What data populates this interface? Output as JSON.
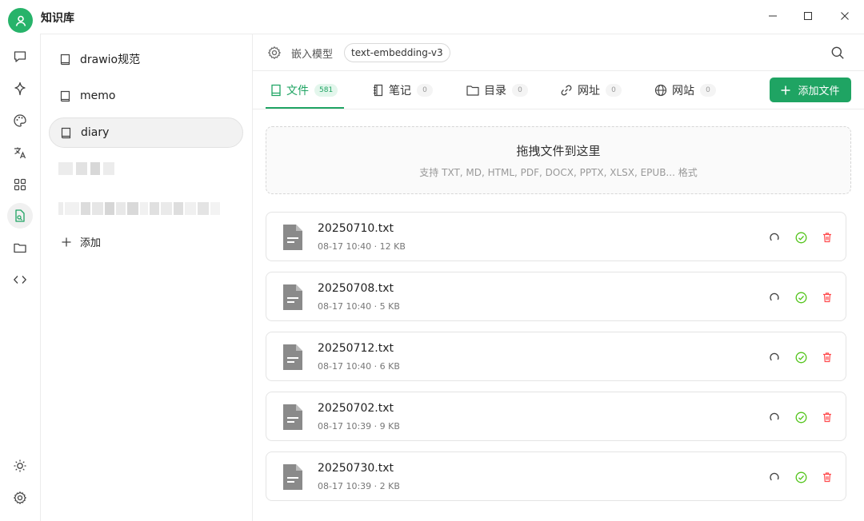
{
  "app": {
    "title": "知识库"
  },
  "window_controls": {
    "minimize": "minimize-icon",
    "maximize": "maximize-icon",
    "close": "close-icon"
  },
  "rail": {
    "items": [
      {
        "icon": "chat-icon"
      },
      {
        "icon": "sparkle-icon"
      },
      {
        "icon": "palette-icon"
      },
      {
        "icon": "translate-icon"
      },
      {
        "icon": "apps-grid-icon"
      },
      {
        "icon": "knowledge-file-icon",
        "active": true
      },
      {
        "icon": "folder-icon"
      },
      {
        "icon": "code-icon"
      }
    ],
    "bottom": [
      {
        "icon": "sun-icon"
      },
      {
        "icon": "settings-icon"
      }
    ]
  },
  "knowledge_bases": {
    "items": [
      {
        "label": "drawio规范"
      },
      {
        "label": "memo"
      },
      {
        "label": "diary",
        "active": true
      }
    ],
    "add_label": "添加"
  },
  "model_bar": {
    "label": "嵌入模型",
    "model": "text-embedding-v3"
  },
  "tabs": [
    {
      "label": "文件",
      "count": "581",
      "active": true
    },
    {
      "label": "笔记",
      "count": "0"
    },
    {
      "label": "目录",
      "count": "0"
    },
    {
      "label": "网址",
      "count": "0"
    },
    {
      "label": "网站",
      "count": "0"
    }
  ],
  "add_file_button": {
    "label": "添加文件"
  },
  "drop_zone": {
    "title": "拖拽文件到这里",
    "subtitle": "支持 TXT, MD, HTML, PDF, DOCX, PPTX, XLSX, EPUB... 格式"
  },
  "files": [
    {
      "name": "20250710.txt",
      "meta": "08-17 10:40 · 12 KB"
    },
    {
      "name": "20250708.txt",
      "meta": "08-17 10:40 · 5 KB"
    },
    {
      "name": "20250712.txt",
      "meta": "08-17 10:40 · 6 KB"
    },
    {
      "name": "20250702.txt",
      "meta": "08-17 10:39 · 9 KB"
    },
    {
      "name": "20250730.txt",
      "meta": "08-17 10:39 · 2 KB"
    }
  ],
  "colors": {
    "accent": "#1fa463",
    "success": "#52c41a",
    "danger": "#ff4d4f"
  }
}
